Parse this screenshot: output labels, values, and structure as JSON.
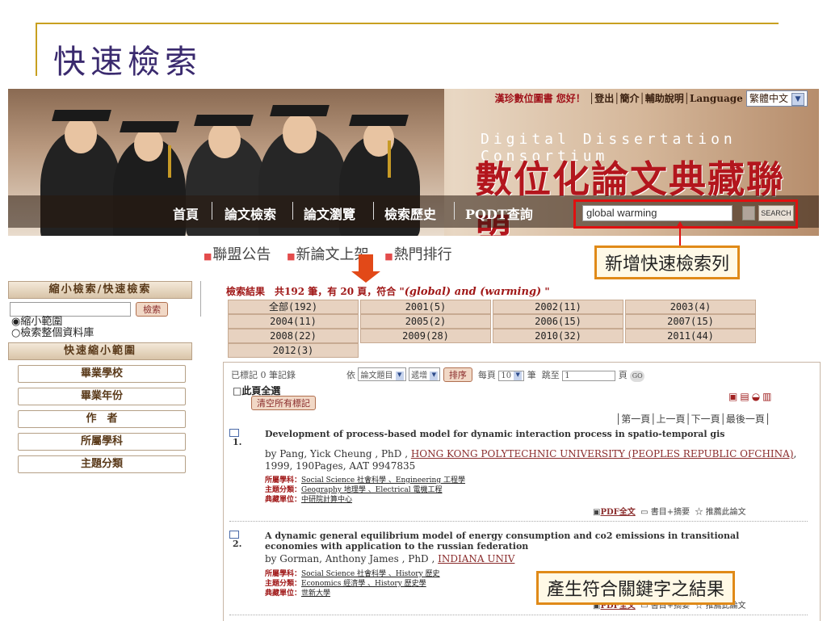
{
  "slide": {
    "title": "快速檢索"
  },
  "banner": {
    "greeting_name": "漢珍數位圖書 您好！",
    "links": [
      "登出",
      "簡介",
      "輔助說明",
      "Language"
    ],
    "language": "繁體中文",
    "title_en": "Digital Dissertation Consortium",
    "title_zh": "數位化論文典藏聯盟",
    "nav": [
      "首頁",
      "論文檢索",
      "論文瀏覽",
      "檢索歷史",
      "PQDT查詢"
    ],
    "search_value": "global warming",
    "search_button": "SEARCH"
  },
  "subnav": [
    "聯盟公告",
    "新論文上架",
    "熱門排行"
  ],
  "callouts": {
    "top": "新增快速檢索列",
    "bottom": "產生符合關鍵字之結果"
  },
  "sidebar": {
    "title": "縮小檢索/快速檢索",
    "search_button": "檢索",
    "radio1": "◉縮小範圍",
    "radio2": "○檢索整個資料庫",
    "section_title": "快速縮小範圍",
    "items": [
      "畢業學校",
      "畢業年份",
      "作　者",
      "所屬學科",
      "主題分類"
    ]
  },
  "results": {
    "summary": "檢索結果　共192 筆，有 20 頁，符合 \"",
    "query": "(global) and (warming)",
    "summary_end": " \"",
    "years": [
      "全部(192)",
      "2001(5)",
      "2002(11)",
      "2003(4)",
      "2004(11)",
      "2005(2)",
      "2006(15)",
      "2007(15)",
      "2008(22)",
      "2009(28)",
      "2010(32)",
      "2011(44)",
      "2012(3)"
    ],
    "marked": "已標記 0 筆記錄",
    "sort_by_label": "依",
    "sort_field": "論文題目",
    "sort_order": "遞增",
    "sort_button": "排序",
    "per_page_label": "每頁",
    "per_page": "10",
    "per_page_unit": "筆",
    "jump_label": "跳至",
    "jump_value": "1",
    "jump_unit": "頁",
    "go": "GO",
    "select_all": "□此頁全選",
    "clear_marks": "清空所有標記",
    "pager": "│第一頁│上一頁│下一頁│最後一頁│",
    "records": [
      {
        "num": "1.",
        "title": "Development of process-based model for dynamic interaction process in spatio-temporal gis",
        "by_prefix": "by Pang, Yick Cheung , PhD , ",
        "school": "HONG KONG POLYTECHNIC UNIVERSITY (PEOPLES REPUBLIC OFCHINA)",
        "by_suffix": ", 1999, 190Pages, AAT 9947835",
        "subject": "Social Science 社會科學 、Engineering 工程學",
        "topic": "Geography 地理學 、Electrical 電機工程",
        "holder": "中研院計算中心",
        "pdf": "PDF全文",
        "abstract": "書目+摘要",
        "recommend": "推薦此論文"
      },
      {
        "num": "2.",
        "title": "A dynamic general equilibrium model of energy consumption and co2 emissions in transitional economies with application to the russian federation",
        "by_prefix": "by Gorman, Anthony James , PhD , ",
        "school": "INDIANA UNIV",
        "by_suffix": "",
        "subject": "Social Science 社會科學 、History 歷史",
        "topic": "Economics 經濟學 、History 歷史學",
        "holder": "世新大學",
        "pdf": "PDF全文",
        "abstract": "書目+摘要",
        "recommend": "推薦此論文"
      }
    ],
    "meta_labels": {
      "subject": "所屬學科：",
      "topic": "主題分類：",
      "holder": "典藏單位："
    }
  },
  "colors": {
    "accent_red": "#b3161d",
    "callout_border": "#e08a18",
    "tab_bg": "#e7d2c0",
    "search_border": "#e01010"
  }
}
